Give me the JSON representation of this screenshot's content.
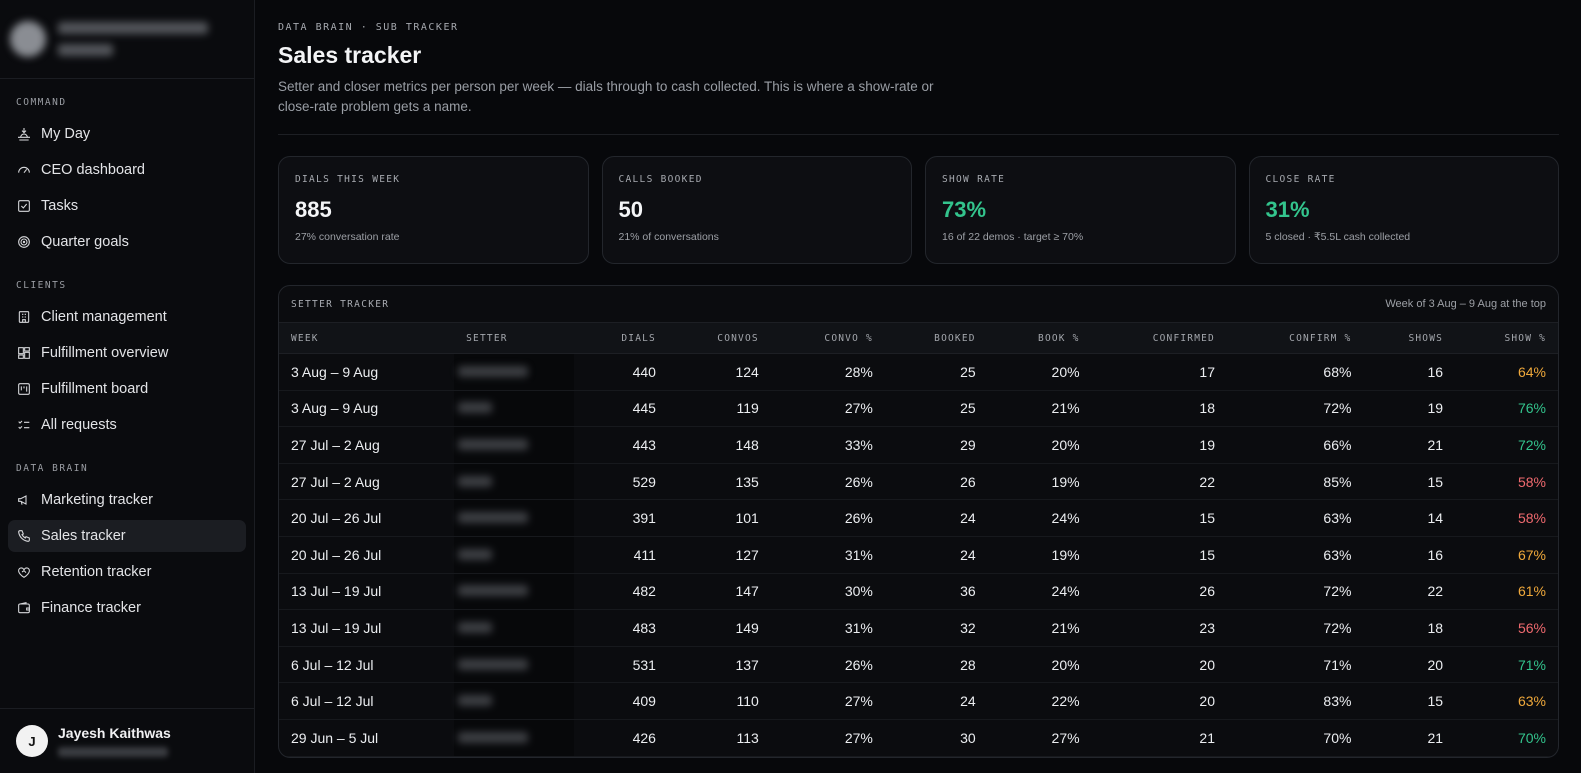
{
  "sidebar": {
    "sections": [
      {
        "title": "COMMAND",
        "items": [
          {
            "label": "My Day",
            "icon": "sunrise-icon"
          },
          {
            "label": "CEO dashboard",
            "icon": "gauge-icon"
          },
          {
            "label": "Tasks",
            "icon": "checkbox-icon"
          },
          {
            "label": "Quarter goals",
            "icon": "target-icon"
          }
        ]
      },
      {
        "title": "CLIENTS",
        "items": [
          {
            "label": "Client management",
            "icon": "building-icon"
          },
          {
            "label": "Fulfillment overview",
            "icon": "dashboard-grid-icon"
          },
          {
            "label": "Fulfillment board",
            "icon": "kanban-icon"
          },
          {
            "label": "All requests",
            "icon": "list-checks-icon"
          }
        ]
      },
      {
        "title": "DATA BRAIN",
        "items": [
          {
            "label": "Marketing tracker",
            "icon": "megaphone-icon"
          },
          {
            "label": "Sales tracker",
            "icon": "phone-icon",
            "active": true
          },
          {
            "label": "Retention tracker",
            "icon": "heart-handshake-icon"
          },
          {
            "label": "Finance tracker",
            "icon": "wallet-icon"
          }
        ]
      }
    ],
    "user": {
      "initial": "J",
      "name": "Jayesh Kaithwas"
    }
  },
  "header": {
    "breadcrumb": "DATA BRAIN · SUB TRACKER",
    "title": "Sales tracker",
    "description": "Setter and closer metrics per person per week — dials through to cash collected. This is where a show-rate or close-rate problem gets a name."
  },
  "cards": [
    {
      "label": "DIALS THIS WEEK",
      "value": "885",
      "sub": "27% conversation rate",
      "tone": "default"
    },
    {
      "label": "CALLS BOOKED",
      "value": "50",
      "sub": "21% of conversations",
      "tone": "default"
    },
    {
      "label": "SHOW RATE",
      "value": "73%",
      "sub": "16 of 22 demos · target ≥ 70%",
      "tone": "green"
    },
    {
      "label": "CLOSE RATE",
      "value": "31%",
      "sub": "5 closed · ₹5.5L cash collected",
      "tone": "green"
    }
  ],
  "table": {
    "title": "SETTER TRACKER",
    "note": "Week of 3 Aug – 9 Aug at the top",
    "columns": [
      "WEEK",
      "SETTER",
      "DIALS",
      "CONVOS",
      "CONVO %",
      "BOOKED",
      "BOOK %",
      "CONFIRMED",
      "CONFIRM %",
      "SHOWS",
      "SHOW %"
    ],
    "status_colors": {
      "good": "#33c48d",
      "warn": "#f0a93b",
      "bad": "#f06a6f"
    },
    "rows": [
      {
        "week": "3 Aug – 9 Aug",
        "setter_w": 70,
        "dials": "440",
        "convos": "124",
        "convo_pct": "28%",
        "booked": "25",
        "book_pct": "20%",
        "confirmed": "17",
        "confirm_pct": "68%",
        "shows": "16",
        "show_pct": "64%",
        "status": "warn"
      },
      {
        "week": "3 Aug – 9 Aug",
        "setter_w": 34,
        "dials": "445",
        "convos": "119",
        "convo_pct": "27%",
        "booked": "25",
        "book_pct": "21%",
        "confirmed": "18",
        "confirm_pct": "72%",
        "shows": "19",
        "show_pct": "76%",
        "status": "good"
      },
      {
        "week": "27 Jul – 2 Aug",
        "setter_w": 70,
        "dials": "443",
        "convos": "148",
        "convo_pct": "33%",
        "booked": "29",
        "book_pct": "20%",
        "confirmed": "19",
        "confirm_pct": "66%",
        "shows": "21",
        "show_pct": "72%",
        "status": "good"
      },
      {
        "week": "27 Jul – 2 Aug",
        "setter_w": 34,
        "dials": "529",
        "convos": "135",
        "convo_pct": "26%",
        "booked": "26",
        "book_pct": "19%",
        "confirmed": "22",
        "confirm_pct": "85%",
        "shows": "15",
        "show_pct": "58%",
        "status": "bad"
      },
      {
        "week": "20 Jul – 26 Jul",
        "setter_w": 70,
        "dials": "391",
        "convos": "101",
        "convo_pct": "26%",
        "booked": "24",
        "book_pct": "24%",
        "confirmed": "15",
        "confirm_pct": "63%",
        "shows": "14",
        "show_pct": "58%",
        "status": "bad"
      },
      {
        "week": "20 Jul – 26 Jul",
        "setter_w": 34,
        "dials": "411",
        "convos": "127",
        "convo_pct": "31%",
        "booked": "24",
        "book_pct": "19%",
        "confirmed": "15",
        "confirm_pct": "63%",
        "shows": "16",
        "show_pct": "67%",
        "status": "warn"
      },
      {
        "week": "13 Jul – 19 Jul",
        "setter_w": 70,
        "dials": "482",
        "convos": "147",
        "convo_pct": "30%",
        "booked": "36",
        "book_pct": "24%",
        "confirmed": "26",
        "confirm_pct": "72%",
        "shows": "22",
        "show_pct": "61%",
        "status": "warn"
      },
      {
        "week": "13 Jul – 19 Jul",
        "setter_w": 34,
        "dials": "483",
        "convos": "149",
        "convo_pct": "31%",
        "booked": "32",
        "book_pct": "21%",
        "confirmed": "23",
        "confirm_pct": "72%",
        "shows": "18",
        "show_pct": "56%",
        "status": "bad"
      },
      {
        "week": "6 Jul – 12 Jul",
        "setter_w": 70,
        "dials": "531",
        "convos": "137",
        "convo_pct": "26%",
        "booked": "28",
        "book_pct": "20%",
        "confirmed": "20",
        "confirm_pct": "71%",
        "shows": "20",
        "show_pct": "71%",
        "status": "good"
      },
      {
        "week": "6 Jul – 12 Jul",
        "setter_w": 34,
        "dials": "409",
        "convos": "110",
        "convo_pct": "27%",
        "booked": "24",
        "book_pct": "22%",
        "confirmed": "20",
        "confirm_pct": "83%",
        "shows": "15",
        "show_pct": "63%",
        "status": "warn"
      },
      {
        "week": "29 Jun – 5 Jul",
        "setter_w": 70,
        "dials": "426",
        "convos": "113",
        "convo_pct": "27%",
        "booked": "30",
        "book_pct": "27%",
        "confirmed": "21",
        "confirm_pct": "70%",
        "shows": "21",
        "show_pct": "70%",
        "status": "good"
      }
    ]
  }
}
